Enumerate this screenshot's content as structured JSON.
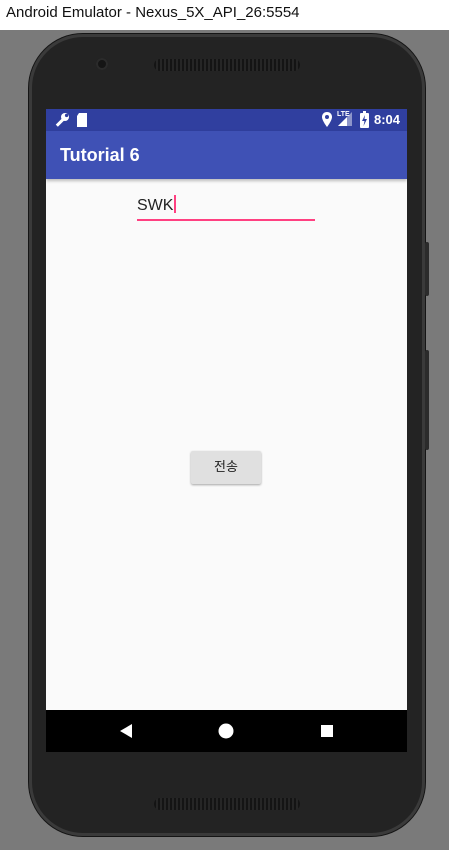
{
  "window": {
    "title": "Android Emulator - Nexus_5X_API_26:5554"
  },
  "status_bar": {
    "time": "8:04",
    "network_label": "LTE",
    "left_icons": [
      "wrench-icon",
      "sd-card-icon"
    ],
    "right_icons": [
      "location-icon",
      "lte-signal-icon",
      "battery-charging-icon"
    ]
  },
  "app_bar": {
    "title": "Tutorial 6"
  },
  "edit_text": {
    "value": "SWK"
  },
  "send_button": {
    "label": "전송"
  },
  "nav_bar": {
    "icons": [
      "back-icon",
      "home-icon",
      "recents-icon"
    ]
  },
  "colors": {
    "primary": "#3f51b5",
    "primary_dark": "#303f9f",
    "accent": "#ff4081",
    "background": "#fafafa",
    "button": "#e0e0e0"
  }
}
